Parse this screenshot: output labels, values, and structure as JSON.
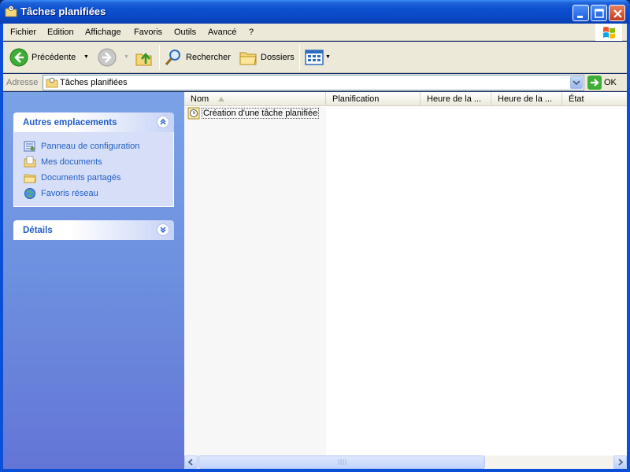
{
  "window": {
    "title": "Tâches planifiées",
    "icon": "scheduled-tasks-folder-icon"
  },
  "menu": {
    "items": [
      "Fichier",
      "Edition",
      "Affichage",
      "Favoris",
      "Outils",
      "Avancé",
      "?"
    ]
  },
  "toolbar": {
    "back_label": "Précédente",
    "search_label": "Rechercher",
    "folders_label": "Dossiers"
  },
  "address": {
    "label": "Adresse",
    "value": "Tâches planifiées",
    "go_label": "OK"
  },
  "taskpane": {
    "other_places": {
      "title": "Autres emplacements",
      "links": [
        {
          "label": "Panneau de configuration",
          "icon": "control-panel-icon"
        },
        {
          "label": "Mes documents",
          "icon": "my-documents-icon"
        },
        {
          "label": "Documents partagés",
          "icon": "shared-folder-icon"
        },
        {
          "label": "Favoris réseau",
          "icon": "network-places-icon"
        }
      ]
    },
    "details": {
      "title": "Détails"
    }
  },
  "list": {
    "columns": [
      "Nom",
      "Planification",
      "Heure de la ...",
      "Heure de la ...",
      "État"
    ],
    "sorted_by": "Nom",
    "items": [
      {
        "label": "Création d'une tâche planifiée",
        "icon": "add-scheduled-task-icon"
      }
    ]
  },
  "colors": {
    "titlebar": "#0b4fcf",
    "chrome": "#ece9d8",
    "taskpane_top": "#7ba2e7",
    "taskpane_bottom": "#6375d6",
    "link": "#215dc6"
  }
}
